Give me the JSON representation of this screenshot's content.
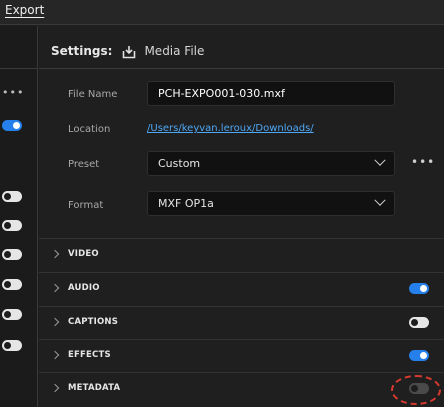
{
  "top_bar": {
    "export_tab": "Export"
  },
  "left_panel": {
    "more_label": "•••",
    "toggles": [
      {
        "state": "on"
      },
      {
        "state": "off"
      },
      {
        "state": "off"
      },
      {
        "state": "off"
      },
      {
        "state": "off"
      },
      {
        "state": "off"
      },
      {
        "state": "off"
      }
    ]
  },
  "settings": {
    "label": "Settings:",
    "destination_icon": "download-icon",
    "destination": "Media File",
    "fields": {
      "file_name": {
        "label": "File Name",
        "value": "PCH-EXPO001-030.mxf"
      },
      "location": {
        "label": "Location",
        "value": "/Users/keyvan.leroux/Downloads/"
      },
      "preset": {
        "label": "Preset",
        "value": "Custom",
        "more_label": "•••"
      },
      "format": {
        "label": "Format",
        "value": "MXF OP1a"
      }
    }
  },
  "sections": [
    {
      "label": "VIDEO",
      "toggle": null
    },
    {
      "label": "AUDIO",
      "toggle": "on"
    },
    {
      "label": "CAPTIONS",
      "toggle": "off"
    },
    {
      "label": "EFFECTS",
      "toggle": "on"
    },
    {
      "label": "METADATA",
      "toggle": "off"
    }
  ],
  "colors": {
    "accent": "#2680eb",
    "link": "#4ea7f5",
    "highlight": "#d63a2f"
  }
}
